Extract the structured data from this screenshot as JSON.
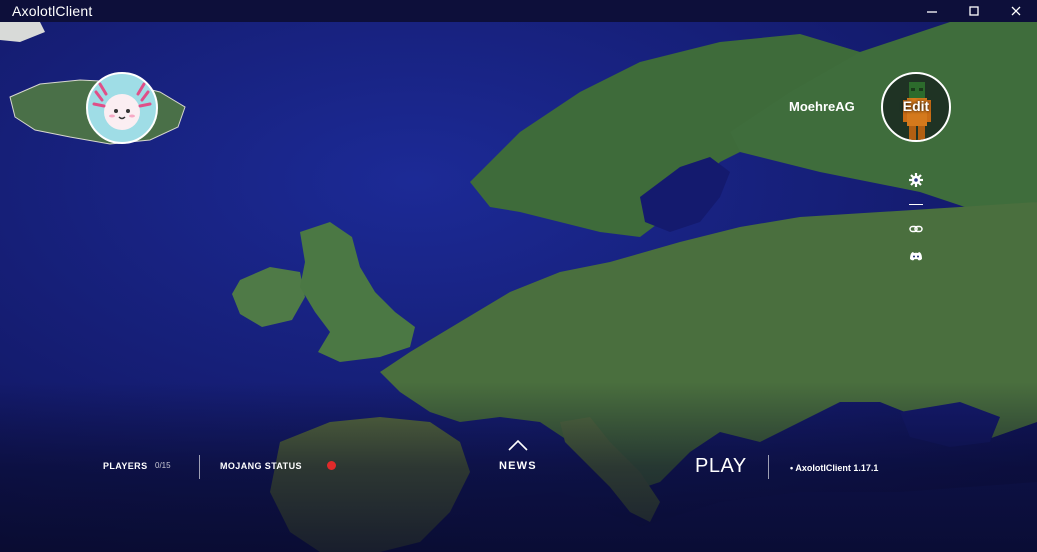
{
  "window": {
    "title": "AxolotlClient",
    "minimize_icon": "minimize-icon",
    "maximize_icon": "maximize-icon",
    "close_icon": "close-icon"
  },
  "profile": {
    "username": "MoehreAG",
    "edit_label": "Edit"
  },
  "sidebar": {
    "icons": [
      "gear-icon",
      "link-icon",
      "discord-icon"
    ]
  },
  "footer": {
    "players_label": "PLAYERS",
    "players_count": "0/15",
    "mojang_status_label": "MOJANG STATUS",
    "mojang_status_color": "#e02a2a",
    "news_label": "NEWS",
    "play_label": "PLAY",
    "version_label": "• AxolotlClient 1.17.1"
  },
  "colors": {
    "ocean": "#141866",
    "land": "#3d6a3a",
    "titlebar": "#0d0f3a"
  }
}
